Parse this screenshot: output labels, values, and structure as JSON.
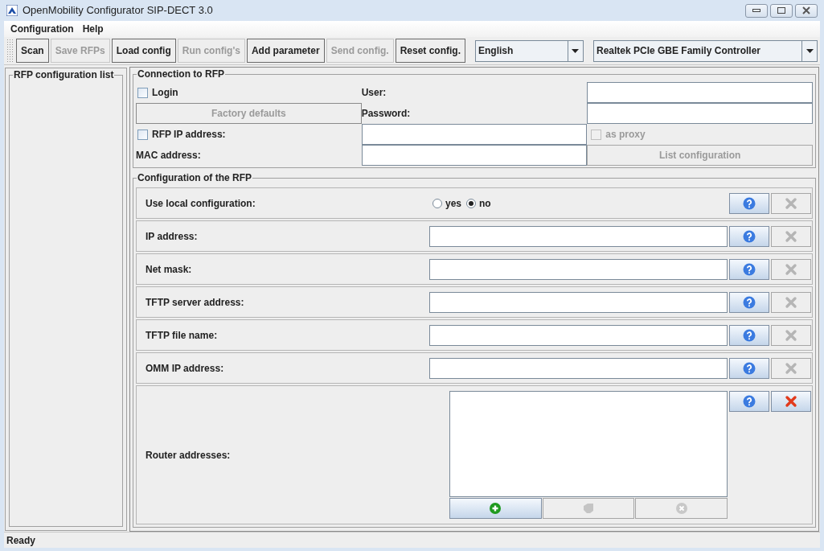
{
  "window": {
    "title": "OpenMobility Configurator SIP-DECT 3.0"
  },
  "menu": [
    "Configuration",
    "Help"
  ],
  "toolbar": {
    "buttons": [
      {
        "label": "Scan",
        "disabled": false
      },
      {
        "label": "Save RFPs",
        "disabled": true
      },
      {
        "label": "Load config",
        "disabled": false
      },
      {
        "label": "Run config's",
        "disabled": true
      },
      {
        "label": "Add parameter",
        "disabled": false
      },
      {
        "label": "Send config.",
        "disabled": true
      },
      {
        "label": "Reset config.",
        "disabled": false
      }
    ],
    "language": "English",
    "adapter": "Realtek PCIe GBE Family Controller"
  },
  "left_panel": {
    "title": "RFP configuration list"
  },
  "connection": {
    "title": "Connection to RFP",
    "login": {
      "label": "Login",
      "checked": false
    },
    "user_label": "User:",
    "password_label": "Password:",
    "factory_defaults": {
      "label": "Factory defaults",
      "disabled": true
    },
    "rfp_ip": {
      "label": "RFP IP address:",
      "checked": false
    },
    "as_proxy": {
      "label": "as proxy",
      "checked": false,
      "disabled": true
    },
    "mac_label": "MAC address:",
    "list_configuration": {
      "label": "List configuration",
      "disabled": true
    }
  },
  "configuration": {
    "title": "Configuration of the RFP",
    "rows": [
      {
        "kind": "radio",
        "label": "Use local configuration:",
        "options": [
          {
            "label": "yes",
            "selected": false
          },
          {
            "label": "no",
            "selected": true
          }
        ],
        "delete_disabled": true
      },
      {
        "kind": "text",
        "label": "IP address:",
        "delete_disabled": true
      },
      {
        "kind": "text",
        "label": "Net mask:",
        "delete_disabled": true
      },
      {
        "kind": "text",
        "label": "TFTP server address:",
        "delete_disabled": true
      },
      {
        "kind": "text",
        "label": "TFTP file name:",
        "delete_disabled": true
      },
      {
        "kind": "text",
        "label": "OMM IP address:",
        "delete_disabled": true
      },
      {
        "kind": "list",
        "label": "Router addresses:",
        "delete_disabled": false,
        "list_buttons": [
          {
            "kind": "add",
            "disabled": false
          },
          {
            "kind": "edit",
            "disabled": true
          },
          {
            "kind": "remove",
            "disabled": true
          }
        ]
      }
    ]
  },
  "status_bar": "Ready"
}
